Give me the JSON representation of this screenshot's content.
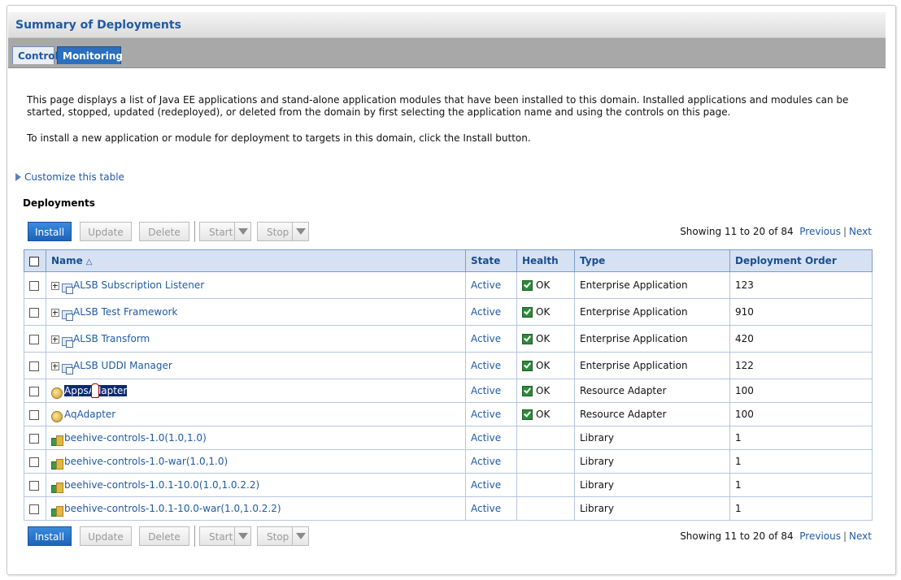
{
  "header": {
    "title": "Summary of Deployments"
  },
  "tabs": [
    {
      "label": "Control"
    },
    {
      "label": "Monitoring"
    }
  ],
  "description": {
    "paragraph1": "This page displays a list of Java EE applications and stand-alone application modules that have been installed to this domain. Installed applications and modules can be started, stopped, updated (redeployed), or deleted from the domain by first selecting the application name and using the controls on this page.",
    "paragraph2": "To install a new application or module for deployment to targets in this domain, click the Install button."
  },
  "customize_link": "Customize this table",
  "section_title": "Deployments",
  "toolbar": {
    "install": "Install",
    "update": "Update",
    "delete": "Delete",
    "start": "Start",
    "stop": "Stop"
  },
  "pager": {
    "showing": "Showing 11 to 20 of 84",
    "previous": "Previous",
    "separator": "|",
    "next": "Next"
  },
  "table": {
    "columns": {
      "name": "Name",
      "state": "State",
      "health": "Health",
      "type": "Type",
      "order": "Deployment Order"
    },
    "rows": [
      {
        "name": "ALSB Subscription Listener",
        "state": "Active",
        "health": "OK",
        "type": "Enterprise Application",
        "order": "123",
        "icon": "enterprise-app-icon"
      },
      {
        "name": "ALSB Test Framework",
        "state": "Active",
        "health": "OK",
        "type": "Enterprise Application",
        "order": "910",
        "icon": "enterprise-app-icon"
      },
      {
        "name": "ALSB Transform",
        "state": "Active",
        "health": "OK",
        "type": "Enterprise Application",
        "order": "420",
        "icon": "enterprise-app-icon"
      },
      {
        "name": "ALSB UDDI Manager",
        "state": "Active",
        "health": "OK",
        "type": "Enterprise Application",
        "order": "122",
        "icon": "enterprise-app-icon"
      },
      {
        "name": "AppsAdapter",
        "state": "Active",
        "health": "OK",
        "type": "Resource Adapter",
        "order": "100",
        "icon": "resource-adapter-icon"
      },
      {
        "name": "AqAdapter",
        "state": "Active",
        "health": "OK",
        "type": "Resource Adapter",
        "order": "100",
        "icon": "resource-adapter-icon"
      },
      {
        "name": "beehive-controls-1.0(1.0,1.0)",
        "state": "Active",
        "health": "",
        "type": "Library",
        "order": "1",
        "icon": "library-icon"
      },
      {
        "name": "beehive-controls-1.0-war(1.0,1.0)",
        "state": "Active",
        "health": "",
        "type": "Library",
        "order": "1",
        "icon": "library-icon"
      },
      {
        "name": "beehive-controls-1.0.1-10.0(1.0,1.0.2.2)",
        "state": "Active",
        "health": "",
        "type": "Library",
        "order": "1",
        "icon": "library-icon"
      },
      {
        "name": "beehive-controls-1.0.1-10.0-war(1.0,1.0.2.2)",
        "state": "Active",
        "health": "",
        "type": "Library",
        "order": "1",
        "icon": "library-icon"
      }
    ]
  }
}
